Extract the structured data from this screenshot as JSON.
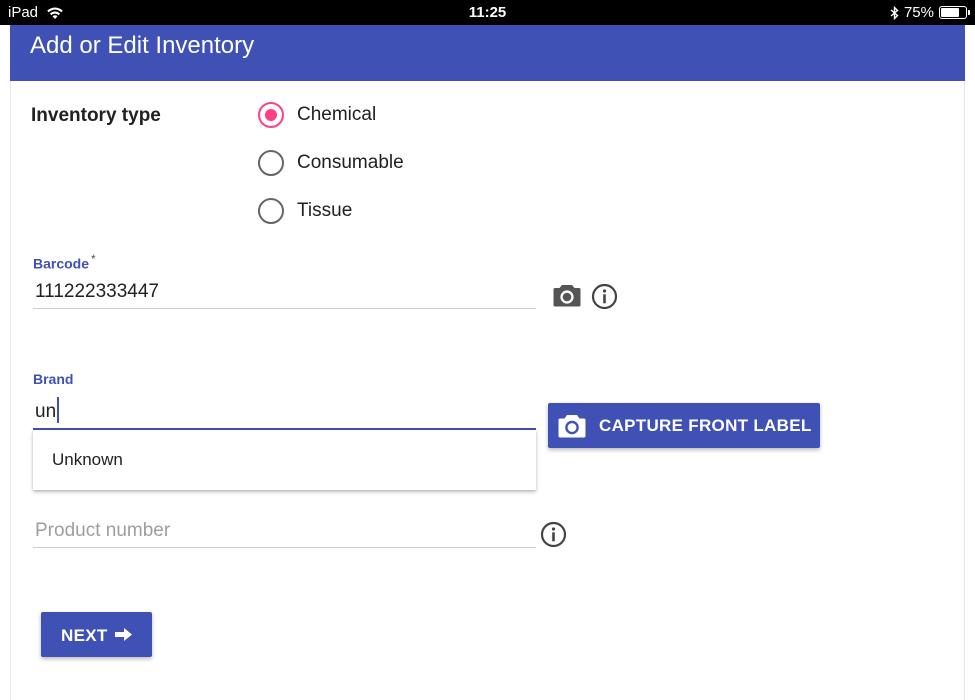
{
  "status_bar": {
    "device": "iPad",
    "time": "11:25",
    "battery": "75%",
    "battery_level": 0.75
  },
  "header": {
    "title": "Add or Edit Inventory"
  },
  "inventory_type": {
    "label": "Inventory type",
    "options": [
      {
        "label": "Chemical",
        "selected": true
      },
      {
        "label": "Consumable",
        "selected": false
      },
      {
        "label": "Tissue",
        "selected": false
      }
    ]
  },
  "barcode": {
    "label": "Barcode",
    "required_mark": "*",
    "value": "111222333447"
  },
  "brand": {
    "label": "Brand",
    "value": "un",
    "suggestions": [
      "Unknown"
    ]
  },
  "product_number": {
    "placeholder": "Product number",
    "value": ""
  },
  "buttons": {
    "capture_front_label": "CAPTURE FRONT LABEL",
    "next": "NEXT"
  },
  "colors": {
    "primary": "#3f51b5",
    "accent": "#ff4081"
  },
  "icons": {
    "camera": "camera-icon",
    "info": "info-icon",
    "arrow": "arrow-right-icon"
  }
}
